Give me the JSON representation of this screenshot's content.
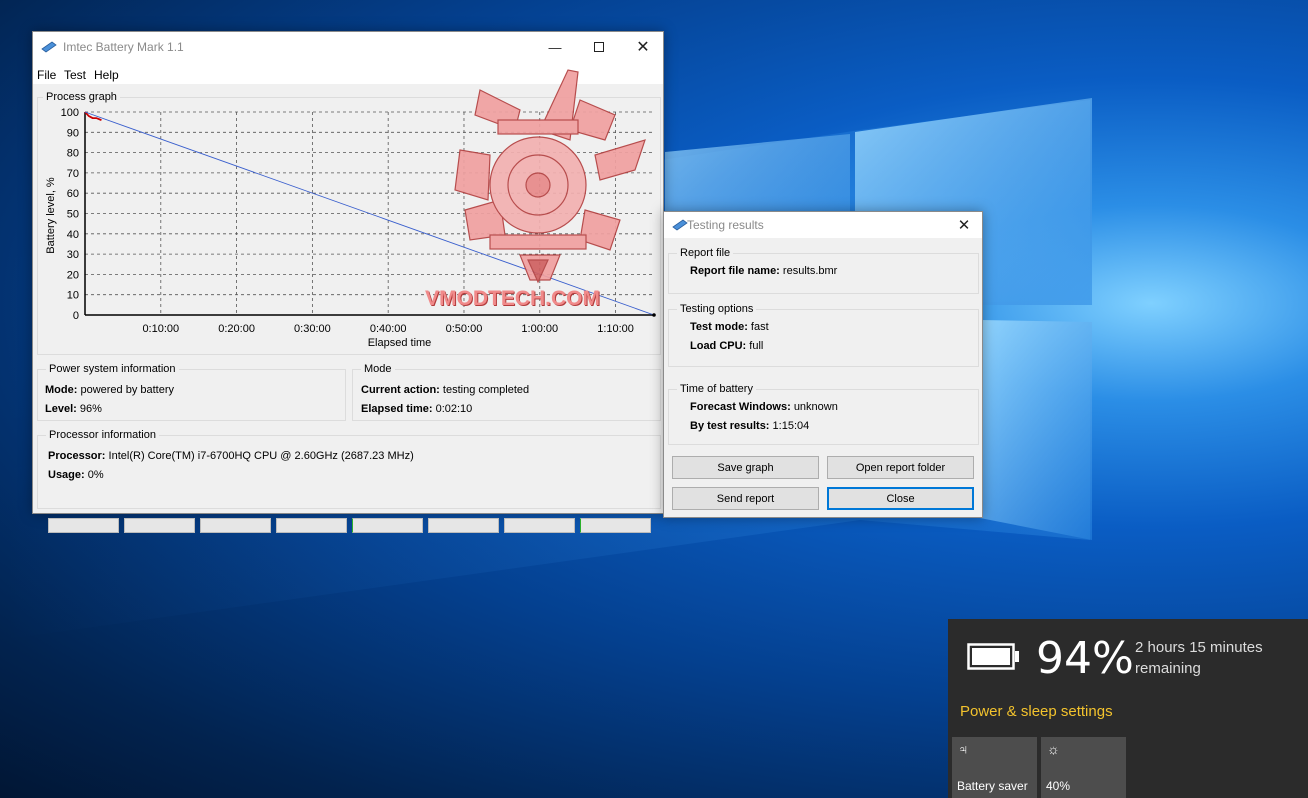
{
  "main_window": {
    "title": "Imtec Battery Mark 1.1",
    "menu": [
      "File",
      "Test",
      "Help"
    ],
    "process_graph_label": "Process graph",
    "power_info": {
      "label": "Power system information",
      "mode_key": "Mode:",
      "mode_value": "powered by battery",
      "level_key": "Level:",
      "level_value": "96%"
    },
    "mode": {
      "label": "Mode",
      "action_key": "Current action:",
      "action_value": "testing completed",
      "elapsed_key": "Elapsed time:",
      "elapsed_value": "0:02:10"
    },
    "processor": {
      "label": "Processor information",
      "cpu_key": "Processor:",
      "cpu_value": "Intel(R) Core(TM) i7-6700HQ CPU @ 2.60GHz  (2687.23 MHz)",
      "usage_key": "Usage:",
      "usage_value": "0%",
      "core_count": 8
    }
  },
  "chart_data": {
    "type": "line",
    "xlabel": "Elapsed time",
    "ylabel": "Battery level, %",
    "ylim": [
      0,
      100
    ],
    "yticks": [
      0,
      10,
      20,
      30,
      40,
      50,
      60,
      70,
      80,
      90,
      100
    ],
    "xlim_minutes": [
      0,
      75.07
    ],
    "xtick_labels": [
      "0:10:00",
      "0:20:00",
      "0:30:00",
      "0:40:00",
      "0:50:00",
      "1:00:00",
      "1:10:00"
    ],
    "xtick_minutes": [
      10,
      20,
      30,
      40,
      50,
      60,
      70
    ],
    "grid": true,
    "series": [
      {
        "role": "measured",
        "color": "#cc0000",
        "minutes": [
          0,
          0.5,
          1.0,
          1.5,
          2.17
        ],
        "values": [
          100,
          98,
          97,
          97,
          96
        ]
      },
      {
        "role": "forecast",
        "color": "#3a5fcd",
        "minutes": [
          0,
          75.07
        ],
        "values": [
          100,
          0
        ]
      }
    ]
  },
  "results_window": {
    "title": "Testing results",
    "report_file": {
      "label": "Report file",
      "name_key": "Report file name:",
      "name_value": "results.bmr"
    },
    "options": {
      "label": "Testing options",
      "mode_key": "Test mode:",
      "mode_value": "fast",
      "cpu_key": "Load CPU:",
      "cpu_value": "full"
    },
    "time": {
      "label": "Time of battery",
      "forecast_key": "Forecast Windows:",
      "forecast_value": "unknown",
      "test_key": "By test results:",
      "test_value": "1:15:04"
    },
    "buttons": {
      "save_graph": "Save graph",
      "open_folder": "Open report folder",
      "send_report": "Send report",
      "close": "Close"
    }
  },
  "watermark_text": "VMODTECH.COM",
  "battery_flyout": {
    "percent": "94%",
    "remaining": "2 hours 15 minutes remaining",
    "settings_link": "Power & sleep settings",
    "tiles": [
      {
        "label": "Battery saver",
        "icon": "battery-saver-icon"
      },
      {
        "label": "40%",
        "icon": "brightness-icon"
      }
    ]
  },
  "colors": {
    "accent": "#0078d7",
    "link": "#f3c32d",
    "measured": "#cc0000",
    "forecast": "#3a5fcd"
  }
}
